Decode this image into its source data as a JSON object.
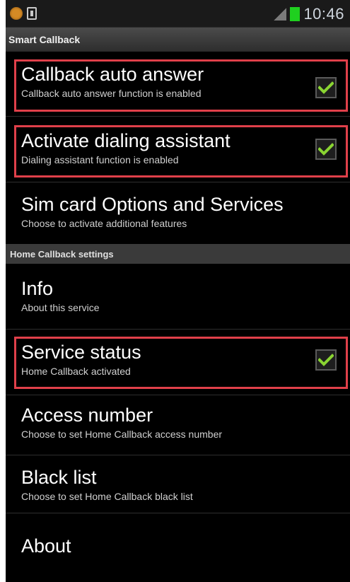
{
  "status_bar": {
    "time": "10:46",
    "icons": [
      "notification-dot-icon",
      "battery-icon",
      "signal-icon",
      "battery-level-icon"
    ]
  },
  "app": {
    "title": "Smart Callback"
  },
  "settings": [
    {
      "title": "Callback auto answer",
      "subtitle": "Callback auto answer function is enabled",
      "checked": true
    },
    {
      "title": "Activate dialing assistant",
      "subtitle": "Dialing assistant function is enabled",
      "checked": true
    },
    {
      "title": "Sim card Options and Services",
      "subtitle": "Choose to activate additional features"
    }
  ],
  "section_header": "Home Callback settings",
  "home_settings": [
    {
      "title": "Info",
      "subtitle": "About this service"
    },
    {
      "title": "Service status",
      "subtitle": "Home Callback activated",
      "checked": true
    },
    {
      "title": "Access number",
      "subtitle": "Choose to set Home Callback access number"
    },
    {
      "title": "Black list",
      "subtitle": "Choose to set Home Callback black list"
    },
    {
      "title": "About"
    }
  ],
  "colors": {
    "highlight": "#e0404a",
    "check": "#8ad432",
    "background": "#000000"
  }
}
